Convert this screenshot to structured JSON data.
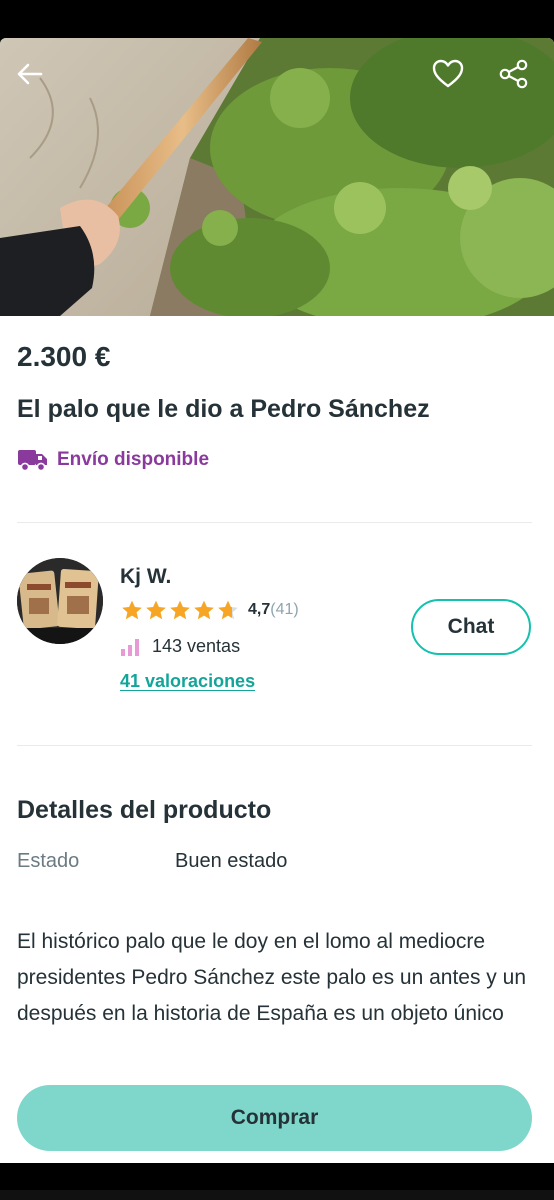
{
  "header": {
    "back_icon": "arrow-left-icon",
    "favorite_icon": "heart-icon",
    "share_icon": "share-icon"
  },
  "product": {
    "price": "2.300 €",
    "title": "El palo que le dio a Pedro Sánchez",
    "shipping_label": "Envío disponible",
    "shipping_icon": "truck-icon"
  },
  "seller": {
    "name": "Kj W.",
    "rating_value": "4,7",
    "rating_count": "(41)",
    "stars": 4.7,
    "sales": "143 ventas",
    "reviews_link": "41 valoraciones",
    "chat_label": "Chat"
  },
  "details": {
    "heading": "Detalles del producto",
    "estado_label": "Estado",
    "estado_value": "Buen estado",
    "description": "El histórico palo que le doy en el lomo al mediocre presidentes Pedro Sánchez este palo es un antes y un después en la historia de España es un objeto único"
  },
  "actions": {
    "buy_label": "Comprar"
  },
  "colors": {
    "brand": "#13c1ac",
    "buy_button": "#7fd7cb",
    "shipping_purple": "#8a3a9c",
    "star": "#f6a624",
    "text": "#253238"
  }
}
